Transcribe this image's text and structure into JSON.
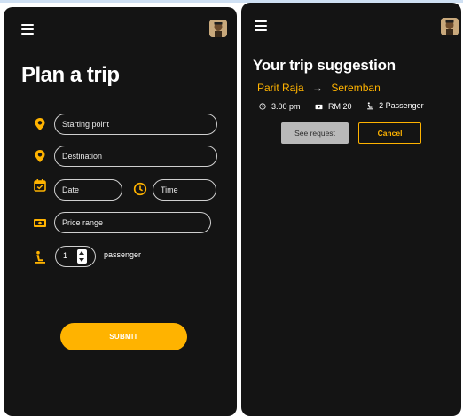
{
  "plan": {
    "title": "Plan a trip",
    "starting_point_placeholder": "Starting point",
    "destination_placeholder": "Destination",
    "date_placeholder": "Date",
    "time_placeholder": "Time",
    "price_placeholder": "Price range",
    "passenger_count": "1",
    "passenger_label": "passenger",
    "submit_label": "SUBMIT"
  },
  "suggestion": {
    "title": "Your trip suggestion",
    "origin": "Parit Raja",
    "arrow": "→",
    "destination": "Seremban",
    "time": "3.00 pm",
    "price": "RM 20",
    "passengers": "2 Passenger",
    "see_request_label": "See request",
    "cancel_label": "Cancel"
  },
  "colors": {
    "background": "#141414",
    "accent": "#ffb300",
    "text": "#ffffff",
    "secondary_button": "#b9b9b9"
  },
  "icons": {
    "menu": "hamburger-icon",
    "avatar": "avatar",
    "start": "location-pin-icon",
    "destination": "location-pin-icon",
    "date": "calendar-icon",
    "time": "clock-icon",
    "price": "money-icon",
    "passenger": "seat-icon"
  }
}
